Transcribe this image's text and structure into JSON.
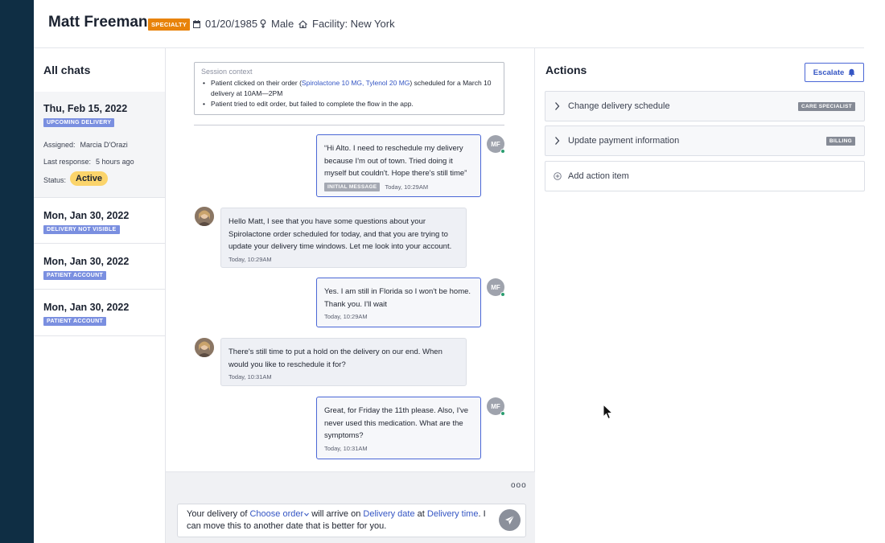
{
  "header": {
    "patient_name": "Matt Freeman",
    "badge": "SPECIALTY",
    "dob": "01/20/1985",
    "sex": "Male",
    "facility": "Facility: New York"
  },
  "chats": {
    "title": "All chats",
    "items": [
      {
        "date": "Thu, Feb 15, 2022",
        "badge": "UPCOMING DELIVERY",
        "assigned_label": "Assigned:",
        "assigned_value": "Marcia D'Orazi",
        "last_label": "Last response:",
        "last_value": "5 hours ago",
        "status_label": "Status:",
        "status_value": "Active"
      },
      {
        "date": "Mon, Jan 30, 2022",
        "badge": "DELIVERY NOT VISIBLE"
      },
      {
        "date": "Mon, Jan 30, 2022",
        "badge": "PATIENT ACCOUNT"
      },
      {
        "date": "Mon, Jan 30, 2022",
        "badge": "PATIENT ACCOUNT"
      }
    ]
  },
  "session": {
    "title": "Session context",
    "line1_a": "Patient clicked on their order (",
    "line1_link": "Spirolactone 10 MG, Tylenol 20 MG",
    "line1_b": ") scheduled for a March 10 delivery at 10AM—2PM",
    "line2": "Patient tried to edit order, but failed to complete the flow in the app."
  },
  "messages": [
    {
      "text": "“Hi Alto. I need to reschedule my delivery because I'm out of town. Tried doing it myself but couldn't. Hope there's still time”",
      "badge": "INITIAL MESSAGE",
      "time": "Today, 10:29AM",
      "avatar": "MF"
    },
    {
      "text": "Hello Matt, I see that you have some questions about your Spirolactone order scheduled for today, and that you are trying to update your delivery time windows. Let me look into your account.",
      "time": "Today, 10:29AM"
    },
    {
      "text": "Yes. I am still in Florida so I won't be home. Thank you. I'll wait",
      "time": "Today, 10:29AM",
      "avatar": "MF"
    },
    {
      "text": "There's still time to put a hold on the delivery on our end. When would you like to reschedule it for?",
      "time": "Today, 10:31AM"
    },
    {
      "text": "Great, for Friday the 11th please. Also, I've never used this medication. What are the symptoms?",
      "time": "Today, 10:31AM",
      "avatar": "MF"
    }
  ],
  "composer": {
    "t1": "Your delivery of ",
    "tok1": "Choose order",
    "t2": " will arrive on ",
    "tok2": "Delivery date",
    "t3": " at ",
    "tok3": "Delivery time",
    "t4": ". I can move this to another date that is better for you."
  },
  "actions": {
    "title": "Actions",
    "escalate": "Escalate",
    "items": [
      {
        "label": "Change delivery schedule",
        "tag": "CARE SPECIALIST"
      },
      {
        "label": "Update payment information",
        "tag": "BILLING"
      },
      {
        "label": "Add action item"
      }
    ]
  },
  "colors": {
    "sidebar": "#0f2e44",
    "accent": "#4a67d6",
    "specialty_badge": "#e8830a",
    "chat_badge": "#7a8fe0",
    "active_status": "#fbd46b"
  }
}
